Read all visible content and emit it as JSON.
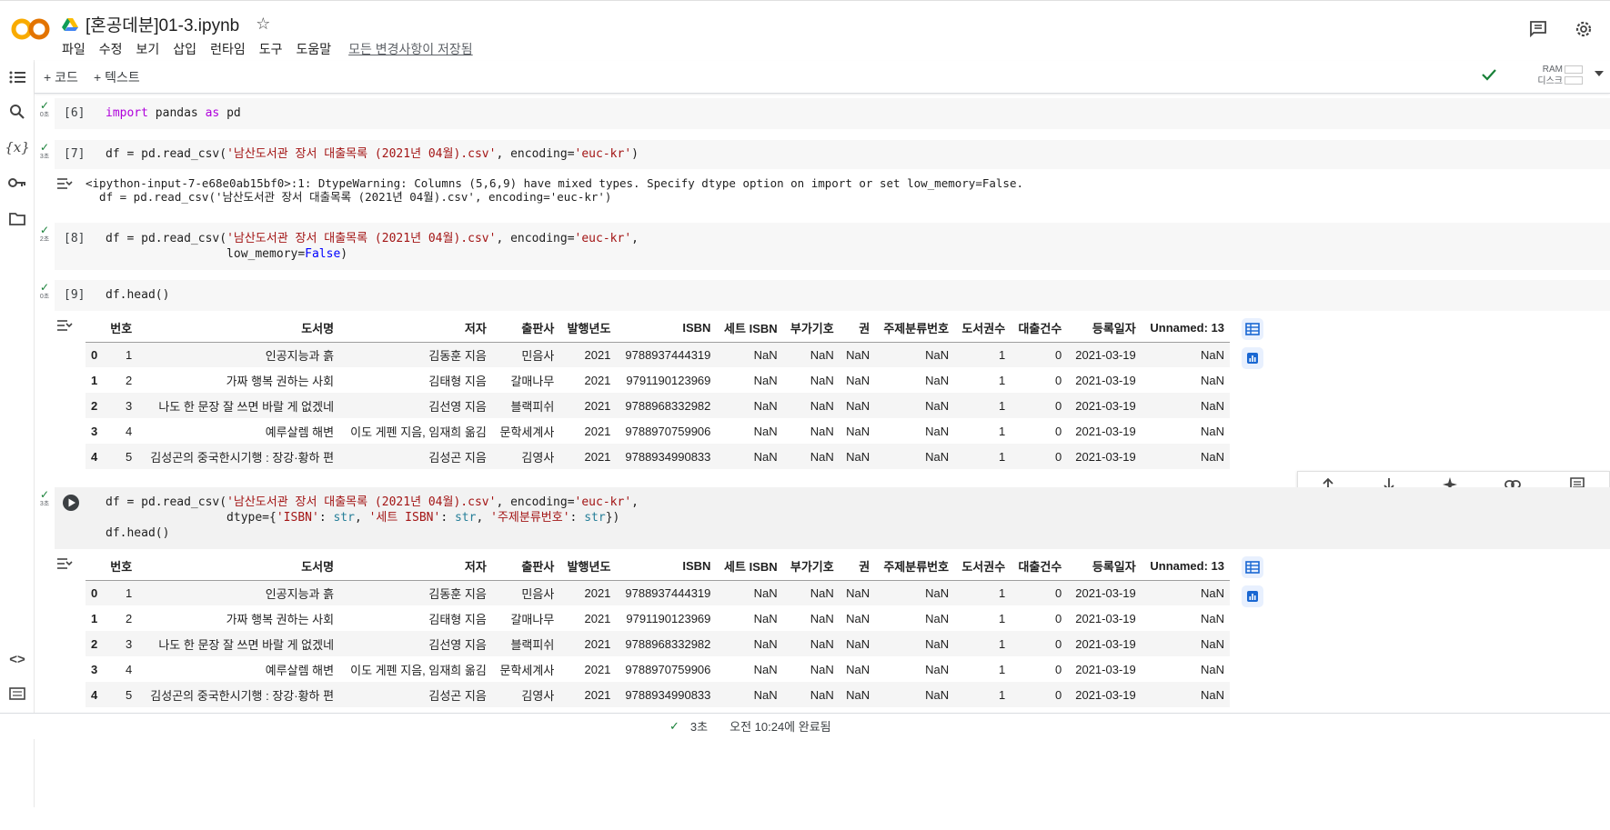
{
  "header": {
    "title": "[혼공데분]01-3.ipynb",
    "menu": [
      "파일",
      "수정",
      "보기",
      "삽입",
      "런타임",
      "도구",
      "도움말"
    ],
    "saved_text": "모든 변경사항이 저장됨"
  },
  "toolbar": {
    "code_label": "+ 코드",
    "text_label": "+ 텍스트",
    "ram_label": "RAM",
    "disk_label": "디스크"
  },
  "cells": {
    "c6": {
      "prompt": "[6]",
      "time": "0초"
    },
    "c7": {
      "prompt": "[7]",
      "time": "3초",
      "output": "<ipython-input-7-e68e0ab15bf0>:1: DtypeWarning: Columns (5,6,9) have mixed types. Specify dtype option on import or set low_memory=False.\n  df = pd.read_csv('남산도서관 장서 대출목록 (2021년 04월).csv', encoding='euc-kr')"
    },
    "c8": {
      "prompt": "[8]",
      "time": "2초"
    },
    "c9": {
      "prompt": "[9]",
      "time": "0초"
    },
    "c10": {
      "time": "3초"
    }
  },
  "dataframe": {
    "columns": [
      "",
      "번호",
      "도서명",
      "저자",
      "출판사",
      "발행년도",
      "ISBN",
      "세트 ISBN",
      "부가기호",
      "권",
      "주제분류번호",
      "도서권수",
      "대출건수",
      "등록일자",
      "Unnamed: 13"
    ],
    "rows": [
      [
        "0",
        "1",
        "인공지능과 흙",
        "김동훈 지음",
        "민음사",
        "2021",
        "9788937444319",
        "NaN",
        "NaN",
        "NaN",
        "NaN",
        "1",
        "0",
        "2021-03-19",
        "NaN"
      ],
      [
        "1",
        "2",
        "가짜 행복 권하는 사회",
        "김태형 지음",
        "갈매나무",
        "2021",
        "9791190123969",
        "NaN",
        "NaN",
        "NaN",
        "NaN",
        "1",
        "0",
        "2021-03-19",
        "NaN"
      ],
      [
        "2",
        "3",
        "나도 한 문장 잘 쓰면 바랄 게 없겠네",
        "김선영 지음",
        "블랙피쉬",
        "2021",
        "9788968332982",
        "NaN",
        "NaN",
        "NaN",
        "NaN",
        "1",
        "0",
        "2021-03-19",
        "NaN"
      ],
      [
        "3",
        "4",
        "예루살렘 해변",
        "이도 게펜 지음, 임재희 옮김",
        "문학세계사",
        "2021",
        "9788970759906",
        "NaN",
        "NaN",
        "NaN",
        "NaN",
        "1",
        "0",
        "2021-03-19",
        "NaN"
      ],
      [
        "4",
        "5",
        "김성곤의 중국한시기행 : 장강·황하 편",
        "김성곤 지음",
        "김영사",
        "2021",
        "9788934990833",
        "NaN",
        "NaN",
        "NaN",
        "NaN",
        "1",
        "0",
        "2021-03-19",
        "NaN"
      ]
    ]
  },
  "status": {
    "duration": "3초",
    "completed": "오전 10:24에 완료됨"
  },
  "colors": {
    "accent": "#1967d2",
    "success": "#188038",
    "code_bg": "#f7f7f7",
    "keyword": "#af00db",
    "string": "#a31515"
  },
  "icons": [
    "toc-icon",
    "search-icon",
    "variables-icon",
    "key-icon",
    "folder-icon",
    "code-snippets-icon",
    "terminal-icon",
    "comment-icon",
    "settings-icon",
    "run-icon",
    "table-icon",
    "chart-icon",
    "arrow-up-icon",
    "arrow-down-icon",
    "sparkle-icon",
    "link-icon"
  ]
}
